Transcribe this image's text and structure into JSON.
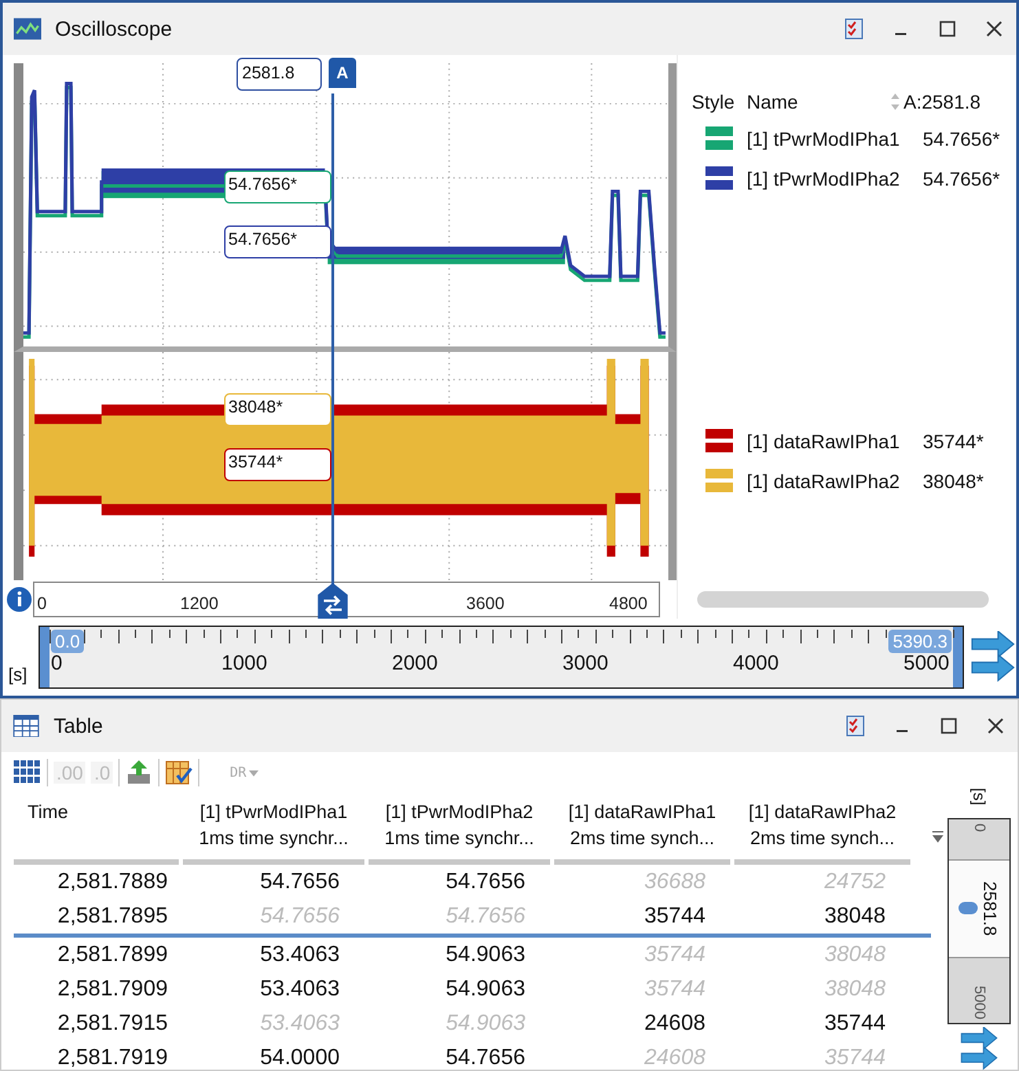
{
  "oscilloscope": {
    "title": "Oscilloscope",
    "cursor": {
      "label": "A",
      "value": "2581.8"
    },
    "upper_markers": [
      {
        "value": "54.7656*",
        "color": "#17a673"
      },
      {
        "value": "54.7656*",
        "color": "#2e3fa6"
      }
    ],
    "lower_markers": [
      {
        "value": "38048*",
        "color": "#e8b83a"
      },
      {
        "value": "35744*",
        "color": "#c00000"
      }
    ],
    "axis_ticks": [
      "0",
      "1200",
      "3600",
      "4800"
    ],
    "legend": {
      "columns": [
        "Style",
        "Name",
        "A:2581.8"
      ],
      "groups": [
        [
          {
            "name": "[1] tPwrModIPha1",
            "value": "54.7656*",
            "color": "#17a673"
          },
          {
            "name": "[1] tPwrModIPha2",
            "value": "54.7656*",
            "color": "#2e3fa6"
          }
        ],
        [
          {
            "name": "[1] dataRawIPha1",
            "value": "35744*",
            "color": "#c00000"
          },
          {
            "name": "[1] dataRawIPha2",
            "value": "38048*",
            "color": "#e8b83a"
          }
        ]
      ]
    },
    "overview": {
      "unit": "[s]",
      "level": 1,
      "start": "0.0",
      "end": "5390.3",
      "ticks": [
        "0",
        "1000",
        "2000",
        "3000",
        "4000",
        "5000"
      ]
    }
  },
  "table": {
    "title": "Table",
    "toolbar": [
      {
        "kind": "grid",
        "disabled": false
      },
      {
        "kind": "more-decimals",
        "label": ".00",
        "disabled": true
      },
      {
        "kind": "fewer-decimals",
        "label": ".0",
        "disabled": true
      },
      {
        "kind": "export",
        "disabled": false
      },
      {
        "kind": "columns",
        "disabled": false
      },
      {
        "kind": "dropdown",
        "label": "DR",
        "disabled": true
      }
    ],
    "columns": [
      {
        "name": "Time"
      },
      {
        "name": "[1] tPwrModIPha1",
        "sub": "1ms time synchr..."
      },
      {
        "name": "[1] tPwrModIPha2",
        "sub": "1ms time synchr..."
      },
      {
        "name": "[1] dataRawIPha1",
        "sub": "2ms time synch..."
      },
      {
        "name": "[1] dataRawIPha2",
        "sub": "2ms time synch..."
      }
    ],
    "rows": [
      {
        "at_cursor": false,
        "cells": [
          {
            "value": "2,581.7889"
          },
          {
            "value": "54.7656",
            "held": false
          },
          {
            "value": "54.7656",
            "held": false
          },
          {
            "value": "36688",
            "held": true
          },
          {
            "value": "24752",
            "held": true
          }
        ]
      },
      {
        "at_cursor": true,
        "cells": [
          {
            "value": "2,581.7895"
          },
          {
            "value": "54.7656",
            "held": true
          },
          {
            "value": "54.7656",
            "held": true
          },
          {
            "value": "35744",
            "held": false
          },
          {
            "value": "38048",
            "held": false
          }
        ]
      },
      {
        "at_cursor": false,
        "cells": [
          {
            "value": "2,581.7899"
          },
          {
            "value": "53.4063",
            "held": false
          },
          {
            "value": "54.9063",
            "held": false
          },
          {
            "value": "35744",
            "held": true
          },
          {
            "value": "38048",
            "held": true
          }
        ]
      },
      {
        "at_cursor": false,
        "cells": [
          {
            "value": "2,581.7909"
          },
          {
            "value": "53.4063",
            "held": false
          },
          {
            "value": "54.9063",
            "held": false
          },
          {
            "value": "35744",
            "held": true
          },
          {
            "value": "38048",
            "held": true
          }
        ]
      },
      {
        "at_cursor": false,
        "cells": [
          {
            "value": "2,581.7915"
          },
          {
            "value": "53.4063",
            "held": true
          },
          {
            "value": "54.9063",
            "held": true
          },
          {
            "value": "24608",
            "held": false
          },
          {
            "value": "35744",
            "held": false
          }
        ]
      },
      {
        "at_cursor": false,
        "cells": [
          {
            "value": "2,581.7919"
          },
          {
            "value": "54.0000",
            "held": false
          },
          {
            "value": "54.7656",
            "held": false
          },
          {
            "value": "24608",
            "held": true
          },
          {
            "value": "35744",
            "held": true
          }
        ]
      }
    ],
    "ruler": {
      "unit": "[s]",
      "start": "0",
      "end": "5000",
      "value": "2581.8"
    }
  }
}
